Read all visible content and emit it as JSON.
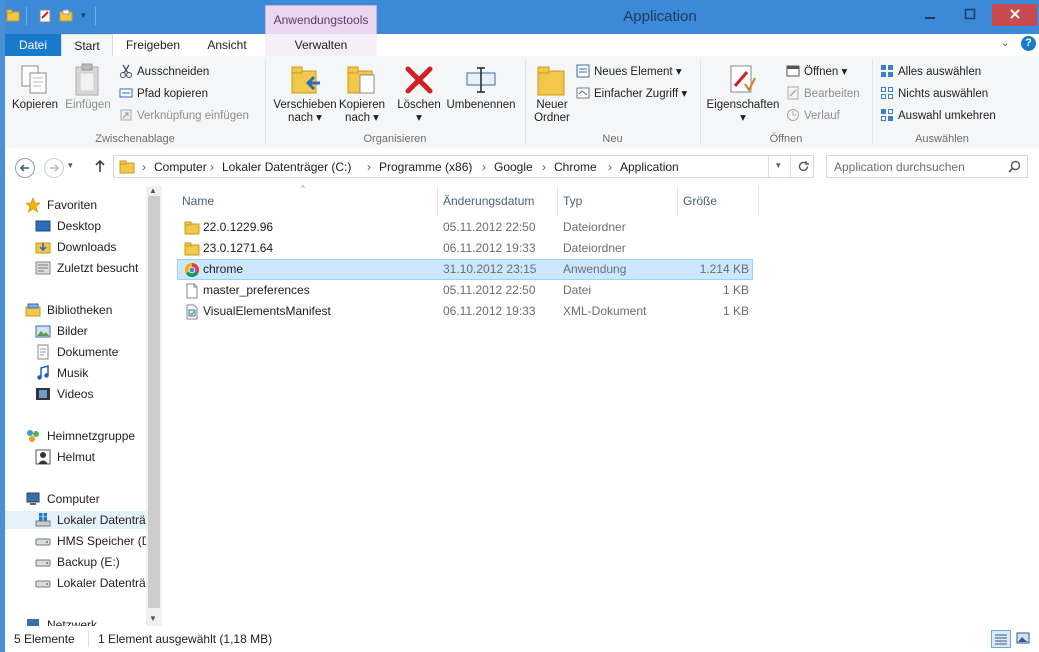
{
  "window": {
    "title": "Application"
  },
  "context_tab": {
    "label": "Anwendungstools"
  },
  "tabs": [
    "Datei",
    "Start",
    "Freigeben",
    "Ansicht",
    "Verwalten"
  ],
  "ribbon": {
    "clipboard": {
      "copy": "Kopieren",
      "paste": "Einfügen",
      "cut": "Ausschneiden",
      "copy_path": "Pfad kopieren",
      "paste_shortcut": "Verknüpfung einfügen",
      "label": "Zwischenablage"
    },
    "organize": {
      "move_to": "Verschieben",
      "move_to_2": "nach",
      "copy_to": "Kopieren",
      "copy_to_2": "nach",
      "delete": "Löschen",
      "rename": "Umbenennen",
      "label": "Organisieren"
    },
    "new": {
      "new_folder": "Neuer",
      "new_folder_2": "Ordner",
      "new_item": "Neues Element",
      "easy_access": "Einfacher Zugriff",
      "label": "Neu"
    },
    "open": {
      "properties": "Eigenschaften",
      "open": "Öffnen",
      "edit": "Bearbeiten",
      "history": "Verlauf",
      "label": "Öffnen"
    },
    "select": {
      "select_all": "Alles auswählen",
      "select_none": "Nichts auswählen",
      "invert": "Auswahl umkehren",
      "label": "Auswählen"
    }
  },
  "address": {
    "crumbs": [
      "Computer",
      "Lokaler Datenträger (C:)",
      "Programme (x86)",
      "Google",
      "Chrome",
      "Application"
    ],
    "search_placeholder": "Application durchsuchen"
  },
  "nav": {
    "favorites": "Favoriten",
    "desktop": "Desktop",
    "downloads": "Downloads",
    "recent": "Zuletzt besucht",
    "libraries": "Bibliotheken",
    "pictures": "Bilder",
    "documents": "Dokumente",
    "music": "Musik",
    "videos": "Videos",
    "homegroup": "Heimnetzgruppe",
    "helmut": "Helmut",
    "computer": "Computer",
    "drive_c": "Lokaler Datenträg",
    "drive_hms": "HMS Speicher (D",
    "drive_backup": "Backup (E:)",
    "drive_local2": "Lokaler Datenträg",
    "network": "Netzwerk"
  },
  "columns": {
    "name": "Name",
    "date": "Änderungsdatum",
    "type": "Typ",
    "size": "Größe"
  },
  "files": [
    {
      "name": "22.0.1229.96",
      "date": "05.11.2012 22:50",
      "type": "Dateiordner",
      "size": ""
    },
    {
      "name": "23.0.1271.64",
      "date": "06.11.2012 19:33",
      "type": "Dateiordner",
      "size": ""
    },
    {
      "name": "chrome",
      "date": "31.10.2012 23:15",
      "type": "Anwendung",
      "size": "1.214 KB"
    },
    {
      "name": "master_preferences",
      "date": "05.11.2012 22:50",
      "type": "Datei",
      "size": "1 KB"
    },
    {
      "name": "VisualElementsManifest",
      "date": "06.11.2012 19:33",
      "type": "XML-Dokument",
      "size": "1 KB"
    }
  ],
  "status": {
    "count": "5 Elemente",
    "selection": "1 Element ausgewählt (1,18 MB)"
  },
  "colors": {
    "titlebar": "#3a8ad8",
    "datei_tab": "#1979ca",
    "selection": "#cce8ff",
    "context_tab": "#e8d8f0"
  }
}
